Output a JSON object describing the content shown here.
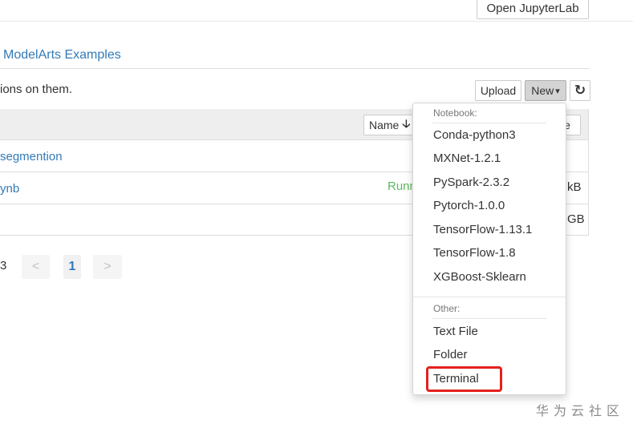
{
  "header": {
    "open_jupyterlab": "Open JupyterLab"
  },
  "tab": {
    "title": "ModelArts Examples"
  },
  "toolbar": {
    "hint": "ions on them.",
    "upload": "Upload",
    "new": "New",
    "new_caret": "▾",
    "refresh_icon": "↻"
  },
  "list": {
    "sort_name": "Name",
    "sort_arrow": "🡣",
    "sort_size_fragment": "e",
    "rows": [
      {
        "name": "segmention",
        "status": "",
        "size": ""
      },
      {
        "name": "ynb",
        "status": "Runn",
        "size": "kB"
      },
      {
        "name": "",
        "status": "",
        "size": "GB"
      }
    ]
  },
  "pagination": {
    "count_fragment": "3",
    "prev": "<",
    "current": "1",
    "next": ">"
  },
  "new_menu": {
    "notebook_header": "Notebook:",
    "kernels": [
      "Conda-python3",
      "MXNet-1.2.1",
      "PySpark-2.3.2",
      "Pytorch-1.0.0",
      "TensorFlow-1.13.1",
      "TensorFlow-1.8",
      "XGBoost-Sklearn"
    ],
    "other_header": "Other:",
    "others": [
      "Text File",
      "Folder",
      "Terminal"
    ],
    "highlight_color": "#e4201d"
  },
  "watermark": "华为云社区"
}
